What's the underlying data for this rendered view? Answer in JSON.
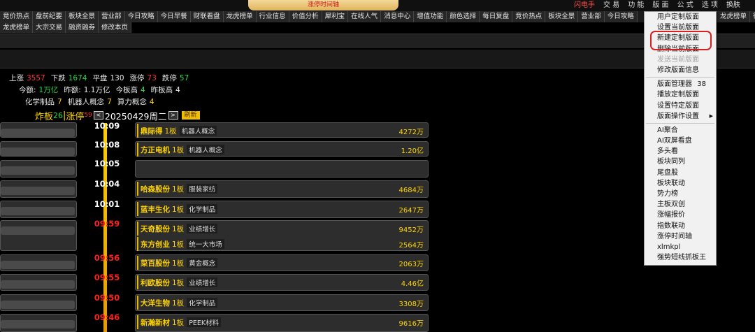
{
  "window": {
    "title": "涨停时间轴",
    "menu": [
      "闪电手",
      "交 易",
      "功 能",
      "版 面",
      "公 式",
      "选 项",
      "换肤"
    ]
  },
  "tabs": [
    "竞价热点",
    "盘前纪要",
    "板块全景",
    "营业部",
    "今日攻略",
    "今日早餐",
    "财联看盘",
    "龙虎榜单",
    "行业信息",
    "价值分析",
    "犀利宝",
    "在线人气",
    "消息中心",
    "增值功能",
    "颜色选择",
    "每日复盘",
    "竞价热点",
    "板块全景",
    "营业部",
    "今日攻略"
  ],
  "tabs_right": [
    "龙虎榜单",
    "行"
  ],
  "tabs2": [
    "龙虎榜单",
    "大宗交易",
    "融资融券",
    "修改本页"
  ],
  "stats": {
    "line1": [
      {
        "l": "上涨",
        "v": "3557",
        "c": "red"
      },
      {
        "l": "下跌",
        "v": "1674",
        "c": "green"
      },
      {
        "l": "平盘",
        "v": "130",
        "c": ""
      },
      {
        "l": "涨停",
        "v": "73",
        "c": "red"
      },
      {
        "l": "跌停",
        "v": "57",
        "c": "green"
      }
    ],
    "line2": [
      {
        "l": "今额:",
        "v": "1万亿",
        "c": "green"
      },
      {
        "l": "昨额:",
        "v": "1.1万亿",
        "c": ""
      },
      {
        "l": "今板高",
        "v": "4",
        "c": "green"
      },
      {
        "l": "昨板高",
        "v": "4",
        "c": ""
      }
    ],
    "line3": [
      {
        "l": "化学制品",
        "v": "7",
        "c": "yellow"
      },
      {
        "l": "机器人概念",
        "v": "7",
        "c": "yellow"
      },
      {
        "l": "算力概念",
        "v": "4",
        "c": "yellow"
      }
    ]
  },
  "header": {
    "zhaban": "炸板",
    "zhaban_n": "26",
    "zhangting": "涨停",
    "zhangting_n": "59",
    "date": "20250429周二",
    "prev": "<",
    "next": ">",
    "refresh": "刷新"
  },
  "timeline": [
    {
      "time": "10:09",
      "color": "white",
      "stocks": [
        {
          "name": "鼎际得",
          "board": "1板",
          "concept": "机器人概念",
          "amt": "4272万"
        }
      ]
    },
    {
      "time": "10:08",
      "color": "white",
      "stocks": [
        {
          "name": "方正电机",
          "board": "1板",
          "concept": "机器人概念",
          "amt": "1.20亿"
        }
      ]
    },
    {
      "time": "10:05",
      "color": "white",
      "stocks": []
    },
    {
      "time": "10:04",
      "color": "white",
      "stocks": [
        {
          "name": "哈森股份",
          "board": "1板",
          "concept": "服装家纺",
          "amt": "4684万"
        }
      ]
    },
    {
      "time": "10:01",
      "color": "white",
      "stocks": [
        {
          "name": "蓝丰生化",
          "board": "1板",
          "concept": "化学制品",
          "amt": "2647万"
        }
      ]
    },
    {
      "time": "09:59",
      "color": "red",
      "stocks": [
        {
          "name": "天奇股份",
          "board": "1板",
          "concept": "业绩增长",
          "amt": "9452万"
        },
        {
          "name": "东方创业",
          "board": "1板",
          "concept": "统一大市场",
          "amt": "2564万"
        }
      ]
    },
    {
      "time": "09:56",
      "color": "red",
      "stocks": [
        {
          "name": "菜百股份",
          "board": "1板",
          "concept": "黄金概念",
          "amt": "2063万"
        }
      ]
    },
    {
      "time": "09:55",
      "color": "red",
      "stocks": [
        {
          "name": "利欧股份",
          "board": "1板",
          "concept": "业绩增长",
          "amt": "4.46亿"
        }
      ]
    },
    {
      "time": "09:50",
      "color": "red",
      "stocks": [
        {
          "name": "大洋生物",
          "board": "1板",
          "concept": "化学制品",
          "amt": "3308万"
        }
      ]
    },
    {
      "time": "09:46",
      "color": "red",
      "stocks": [
        {
          "name": "新瀚新材",
          "board": "1板",
          "concept": "PEEK材料",
          "amt": "9616万"
        }
      ]
    }
  ],
  "dropdown": {
    "group1": [
      {
        "label": "用户定制版面",
        "dis": false
      },
      {
        "label": "设置当前版面",
        "dis": false
      },
      {
        "label": "新建定制版面",
        "dis": false
      },
      {
        "label": "删除当前版面",
        "dis": false
      },
      {
        "label": "发送当前版面",
        "dis": true
      },
      {
        "label": "修改版面信息",
        "dis": false
      }
    ],
    "group2": [
      {
        "label": "版面管理器",
        "num": "38"
      },
      {
        "label": "播放定制版面"
      },
      {
        "label": "设置特定版面"
      },
      {
        "label": "版面操作设置",
        "sub": "▶"
      }
    ],
    "group3": [
      "AI聚合",
      "AI双屏看盘",
      "多头看",
      "板块同列",
      "尾盘股",
      "板块联动",
      "势力榜",
      "主板双创",
      "涨幅报价",
      "指数联动",
      "涨停时间轴",
      "xlmkpl",
      "强势短线抓板王"
    ]
  }
}
